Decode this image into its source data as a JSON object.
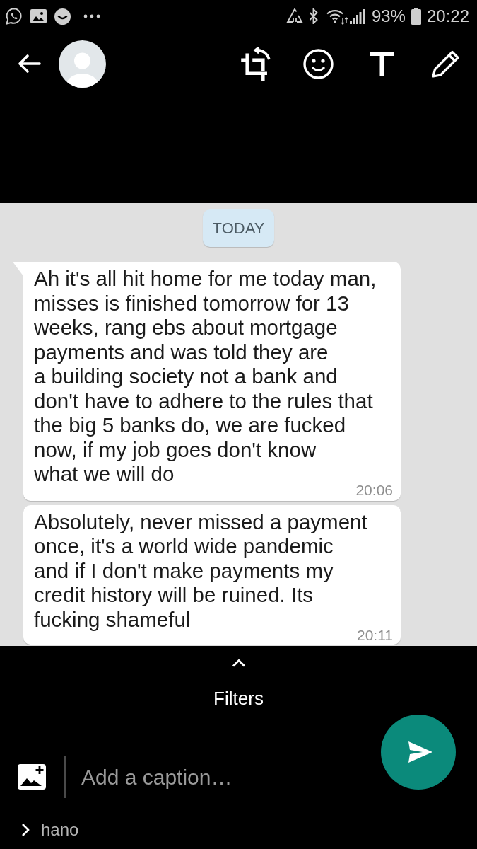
{
  "status_bar": {
    "battery": "93%",
    "time": "20:22"
  },
  "image": {
    "date_chip": "TODAY",
    "messages": [
      {
        "text": "Ah it's all hit home for me today man,\nmisses is finished tomorrow for 13\nweeks, rang ebs about mortgage\npayments and was told they are\na building society not a bank and\ndon't have to adhere to the rules that\nthe big 5 banks do, we are fucked\nnow, if my job goes don't know\nwhat we will do",
        "time": "20:06",
        "tail": true
      },
      {
        "text": "Absolutely, never missed a payment\nonce, it's a world wide pandemic\nand if I don't make payments my\ncredit history will be ruined. Its\nfucking shameful",
        "time": "20:11",
        "tail": false
      }
    ]
  },
  "filters": {
    "label": "Filters"
  },
  "caption": {
    "placeholder": "Add a caption…"
  },
  "recipient": {
    "name": "hano"
  }
}
